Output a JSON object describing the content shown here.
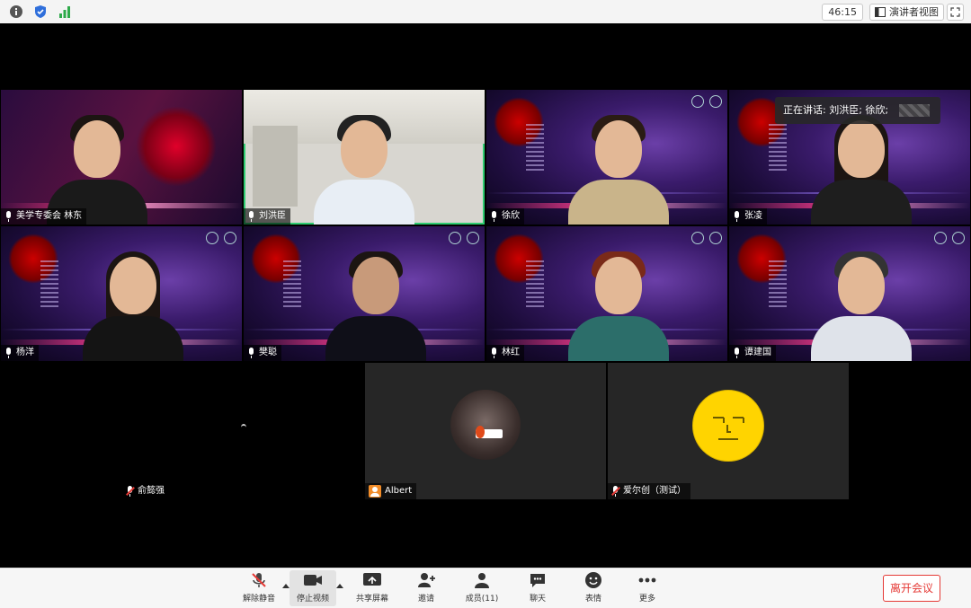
{
  "topbar": {
    "timer": "46:15",
    "view_button": "演讲者视图"
  },
  "speaking": {
    "text": "正在讲话: 刘洪臣; 徐欣;"
  },
  "tiles": [
    {
      "name": "美学专委会 林东",
      "mic": "on"
    },
    {
      "name": "刘洪臣",
      "mic": "on"
    },
    {
      "name": "徐欣",
      "mic": "on"
    },
    {
      "name": "张凌",
      "mic": "on"
    },
    {
      "name": "杨洋",
      "mic": "on"
    },
    {
      "name": "樊聪",
      "mic": "on"
    },
    {
      "name": "林红",
      "mic": "on"
    },
    {
      "name": "谭建国",
      "mic": "on"
    }
  ],
  "bottom_tiles": [
    {
      "name": "俞懿强",
      "mic": "muted"
    },
    {
      "name": "Albert",
      "mic": "none"
    },
    {
      "name": "爱尔创（测试）",
      "mic": "muted"
    }
  ],
  "toolbar": {
    "unmute": "解除静音",
    "stop_video": "停止视频",
    "share_screen": "共享屏幕",
    "invite": "邀请",
    "members": "成员(11)",
    "chat": "聊天",
    "reactions": "表情",
    "more": "更多",
    "leave": "离开会议"
  },
  "colors": {
    "active_speaker_border": "#2ecc71",
    "leave_red": "#e53935",
    "poster_purple": "#3a1b6b"
  }
}
